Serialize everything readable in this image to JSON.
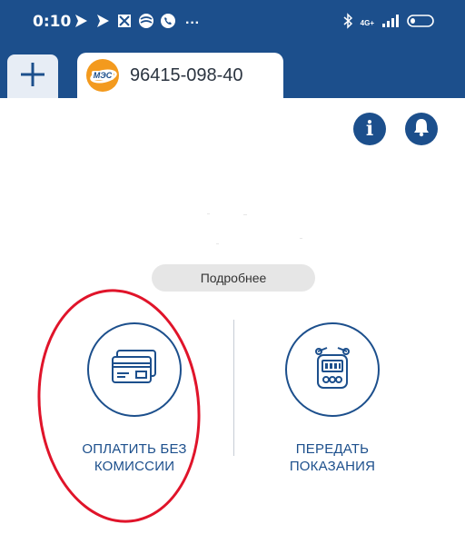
{
  "status_bar": {
    "time": "0:10",
    "more": "···",
    "network": "4G+",
    "left_icons": [
      "play-icon",
      "play-icon",
      "cube-icon",
      "pill-icon",
      "phone-icon"
    ],
    "right_icons": [
      "bluetooth-icon",
      "signal-icon",
      "battery-icon"
    ]
  },
  "tabs": {
    "add_icon": "plus-icon",
    "account": {
      "logo_text": "МЭС",
      "number": "96415-098-40"
    }
  },
  "toolbar": {
    "info_icon": "info-icon",
    "info_glyph": "i",
    "bell_icon": "bell-icon"
  },
  "details_button": {
    "label": "Подробнее"
  },
  "actions": {
    "pay": {
      "label_line1": "ОПЛАТИТЬ БЕЗ",
      "label_line2": "КОМИССИИ",
      "icon": "credit-card-icon"
    },
    "meter": {
      "label_line1": "ПЕРЕДАТЬ",
      "label_line2": "ПОКАЗАНИЯ",
      "icon": "meter-icon"
    }
  },
  "colors": {
    "brand_blue": "#1c4f8c",
    "logo_orange": "#f39a1e",
    "highlight_red": "#e0142a"
  }
}
